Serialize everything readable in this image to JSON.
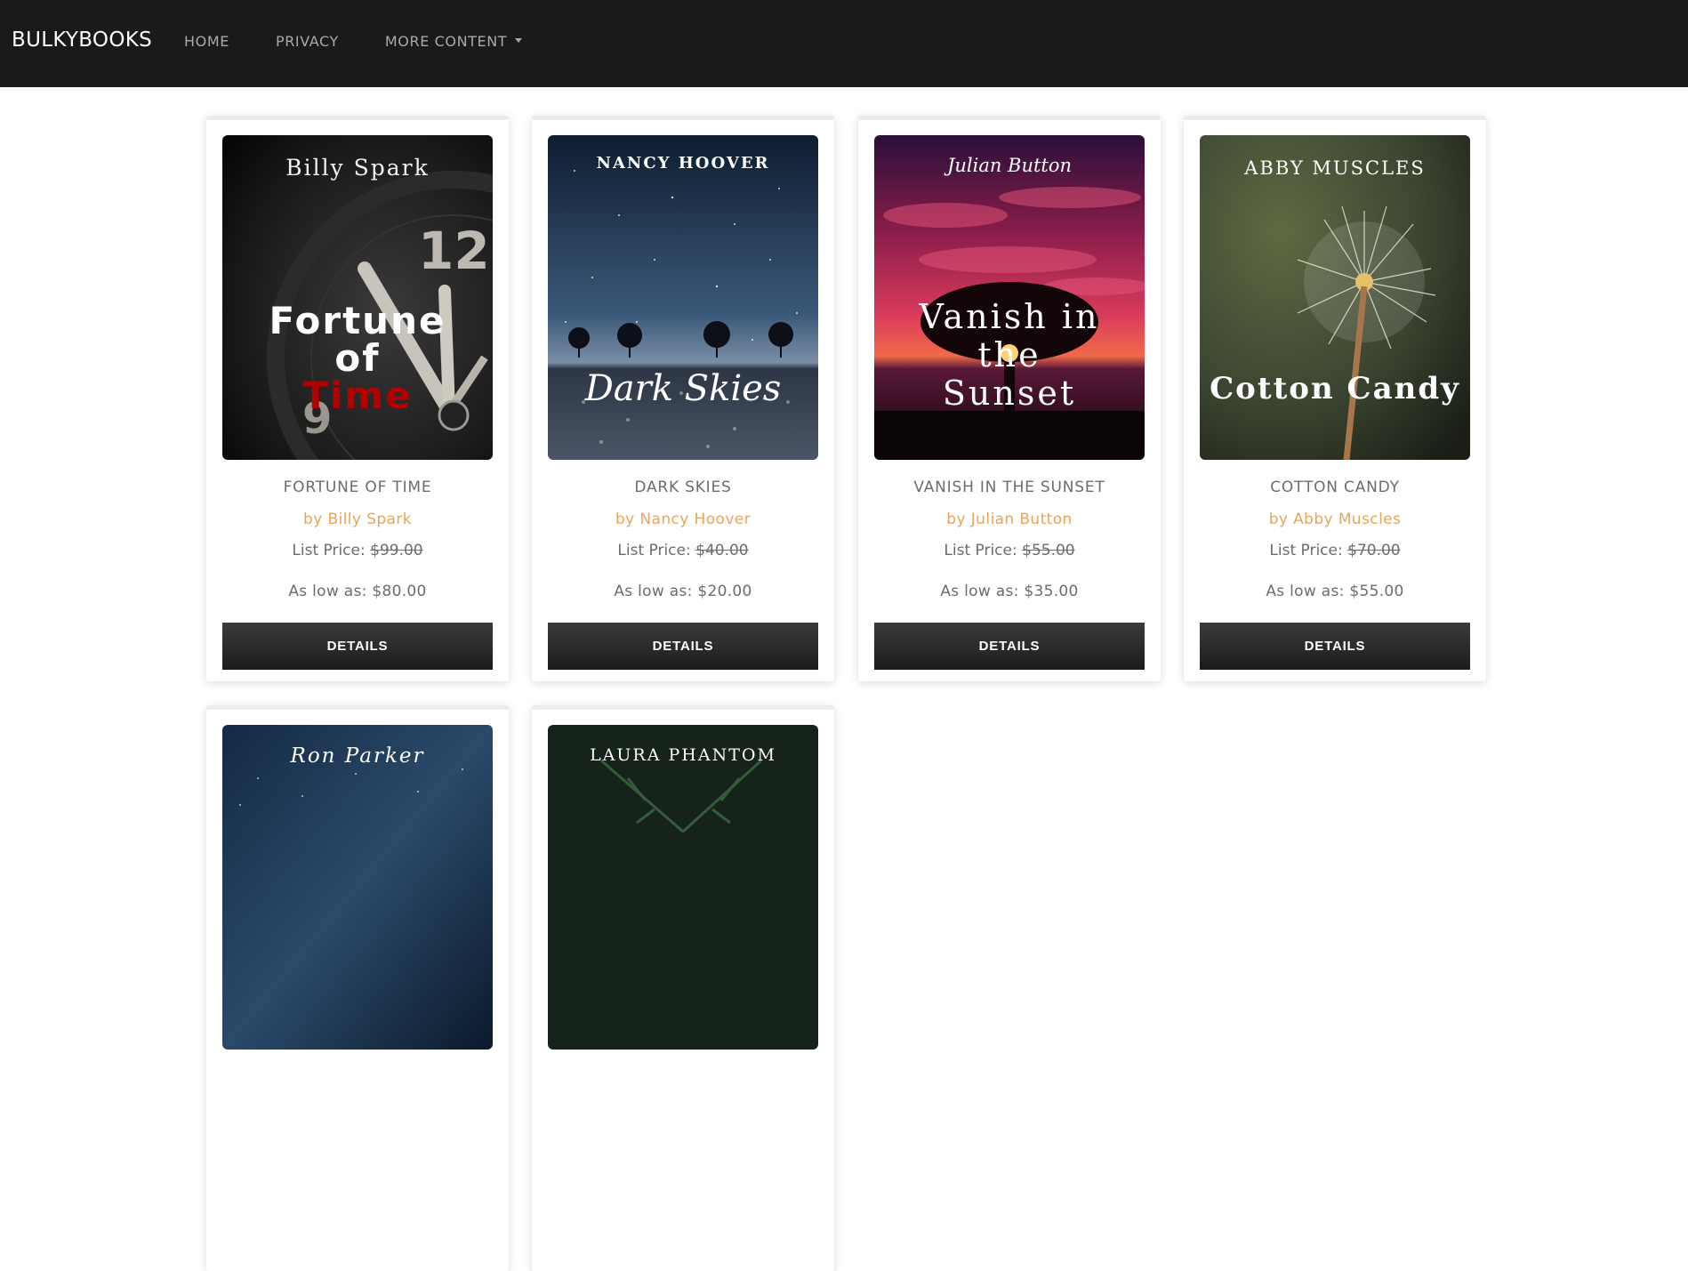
{
  "navbar": {
    "brand": "BULKYBOOKS",
    "links": [
      {
        "label": "HOME"
      },
      {
        "label": "PRIVACY"
      },
      {
        "label": "MORE CONTENT"
      }
    ]
  },
  "products": [
    {
      "title": "FORTUNE OF TIME",
      "author": "by Billy Spark",
      "list_price_label": "List Price:",
      "list_price": "$99.00",
      "low_price": "As low as: $80.00",
      "button_label": "DETAILS",
      "cover": {
        "author": "Billy Spark",
        "title_lines": [
          "Fortune",
          "of",
          "Time"
        ]
      }
    },
    {
      "title": "DARK SKIES",
      "author": "by Nancy Hoover",
      "list_price_label": "List Price:",
      "list_price": "$40.00",
      "low_price": "As low as: $20.00",
      "button_label": "DETAILS",
      "cover": {
        "author": "NANCY HOOVER",
        "title_lines": [
          "Dark Skies"
        ]
      }
    },
    {
      "title": "VANISH IN THE SUNSET",
      "author": "by Julian Button",
      "list_price_label": "List Price:",
      "list_price": "$55.00",
      "low_price": "As low as: $35.00",
      "button_label": "DETAILS",
      "cover": {
        "author": "Julian Button",
        "title_lines": [
          "Vanish in",
          "the",
          "Sunset"
        ]
      }
    },
    {
      "title": "COTTON CANDY",
      "author": "by Abby Muscles",
      "list_price_label": "List Price:",
      "list_price": "$70.00",
      "low_price": "As low as: $55.00",
      "button_label": "DETAILS",
      "cover": {
        "author": "ABBY MUSCLES",
        "title_lines": [
          "Cotton Candy"
        ]
      }
    },
    {
      "cover": {
        "author": "Ron Parker"
      }
    },
    {
      "cover": {
        "author": "LAURA PHANTOM"
      }
    }
  ]
}
